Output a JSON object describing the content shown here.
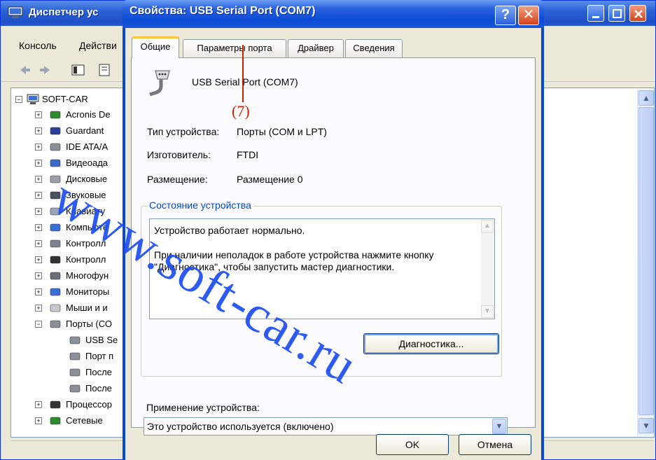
{
  "background_window": {
    "title": "Диспетчер ус",
    "menu": [
      "Консоль",
      "Действи"
    ],
    "tree": {
      "root": "SOFT-CAR",
      "items": [
        {
          "label": "Acronis De",
          "icon": "chip-icon"
        },
        {
          "label": "Guardant",
          "icon": "key-icon"
        },
        {
          "label": "IDE ATA/A",
          "icon": "disk-controller-icon"
        },
        {
          "label": "Видеоада",
          "icon": "display-adapter-icon"
        },
        {
          "label": "Дисковые",
          "icon": "disk-drive-icon"
        },
        {
          "label": "Звуковые",
          "icon": "sound-icon"
        },
        {
          "label": "Клавиату",
          "icon": "keyboard-icon"
        },
        {
          "label": "Компьюте",
          "icon": "computer-icon"
        },
        {
          "label": "Контролл",
          "icon": "controller-icon"
        },
        {
          "label": "Контролл",
          "icon": "usb-icon"
        },
        {
          "label": "Многофун",
          "icon": "multifunction-icon"
        },
        {
          "label": "Мониторы",
          "icon": "monitor-icon"
        },
        {
          "label": "Мыши и и",
          "icon": "mouse-icon"
        },
        {
          "label": "Порты (СО",
          "icon": "port-icon"
        },
        {
          "label": "USB Se",
          "icon": "port-icon"
        },
        {
          "label": "Порт п",
          "icon": "port-icon"
        },
        {
          "label": "После",
          "icon": "port-icon"
        },
        {
          "label": "После",
          "icon": "port-icon"
        },
        {
          "label": "Процессор",
          "icon": "processor-icon"
        },
        {
          "label": "Сетевые",
          "icon": "network-icon"
        }
      ]
    }
  },
  "dialog": {
    "title": "Свойства: USB Serial Port (COM7)",
    "help_label": "?",
    "close_label": "✕",
    "tabs": [
      "Общие",
      "Параметры порта",
      "Драйвер",
      "Сведения"
    ],
    "active_tab": "Общие",
    "device_name": "USB Serial Port (COM7)",
    "fields": {
      "type_label": "Тип устройства:",
      "type_value": "Порты (COM и LPT)",
      "maker_label": "Изготовитель:",
      "maker_value": "FTDI",
      "placement_label": "Размещение:",
      "placement_value": "Размещение 0"
    },
    "status_group_title": "Состояние устройства",
    "status_line1": "Устройство работает нормально.",
    "status_line2": "При наличии неполадок в работе устройства нажмите кнопку \"Диагностика\", чтобы запустить мастер диагностики.",
    "diagnostics_button": "Диагностика...",
    "usage_label": "Применение устройства:",
    "usage_value": "Это устройство используется (включено)",
    "ok_button": "OK",
    "cancel_button": "Отмена"
  },
  "annotation": {
    "label": "(7)",
    "color": "#cc2200"
  },
  "watermark": "www.soft-car.ru"
}
